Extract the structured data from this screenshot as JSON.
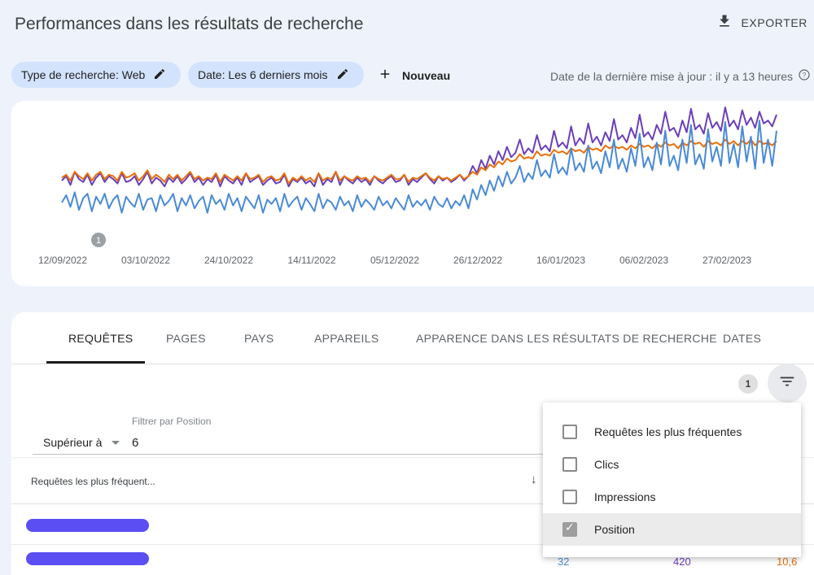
{
  "header": {
    "title": "Performances dans les résultats de recherche",
    "export_label": "EXPORTER",
    "export_icon": "download-icon"
  },
  "filters": {
    "search_type_chip": "Type de recherche: Web",
    "date_chip": "Date: Les 6 derniers mois",
    "new_label": "Nouveau",
    "last_update": "Date de la dernière mise à jour : il y a 13 heures"
  },
  "chart_data": {
    "type": "line",
    "x_ticks": [
      "12/09/2022",
      "03/10/2022",
      "24/10/2022",
      "14/11/2022",
      "05/12/2022",
      "26/12/2022",
      "16/01/2023",
      "06/02/2023",
      "27/02/2023"
    ],
    "annotation": "1",
    "grid": false,
    "colors": {
      "clics": "#4a8ad6",
      "impressions": "#6b3fb8",
      "position": "#e8710a"
    },
    "series": [
      {
        "color": "#6b3fb8",
        "values": [
          50,
          53,
          47,
          56,
          51,
          49,
          54,
          47,
          52,
          55,
          49,
          53,
          51,
          48,
          55,
          49,
          50,
          53,
          47,
          51,
          56,
          48,
          52,
          50,
          46,
          52,
          49,
          53,
          48,
          51,
          55,
          49,
          52,
          47,
          51,
          49,
          54,
          46,
          53,
          50,
          48,
          52,
          47,
          55,
          49,
          51,
          53,
          47,
          50,
          52,
          48,
          49,
          54,
          46,
          51,
          49,
          52,
          48,
          50,
          46,
          55,
          47,
          51,
          49,
          56,
          47,
          53,
          50,
          48,
          52,
          49,
          51,
          47,
          53,
          50,
          48,
          51,
          53,
          49,
          50,
          54,
          47,
          51,
          49,
          52,
          55,
          51,
          48,
          53,
          50,
          52,
          49,
          51,
          54,
          50,
          53,
          60,
          55,
          64,
          58,
          67,
          61,
          70,
          64,
          73,
          66,
          69,
          78,
          68,
          72,
          69,
          81,
          71,
          74,
          70,
          84,
          73,
          76,
          72,
          87,
          74,
          79,
          75,
          89,
          76,
          80,
          74,
          83,
          77,
          92,
          78,
          81,
          76,
          86,
          79,
          95,
          80,
          83,
          78,
          88,
          82,
          97,
          84,
          86,
          80,
          91,
          83,
          99,
          85,
          88,
          82,
          96,
          86,
          90,
          84,
          100,
          87,
          91,
          85,
          98,
          88,
          93,
          86,
          97,
          89,
          91,
          87,
          95
        ]
      },
      {
        "color": "#e8710a",
        "values": [
          52,
          54,
          50,
          56,
          53,
          51,
          55,
          50,
          54,
          56,
          51,
          54,
          53,
          50,
          56,
          52,
          53,
          55,
          50,
          53,
          57,
          51,
          54,
          52,
          49,
          54,
          51,
          54,
          50,
          53,
          56,
          51,
          53,
          50,
          52,
          51,
          55,
          49,
          54,
          52,
          50,
          53,
          50,
          55,
          51,
          52,
          54,
          49,
          52,
          53,
          50,
          51,
          55,
          48,
          52,
          50,
          53,
          50,
          52,
          49,
          55,
          50,
          52,
          51,
          56,
          50,
          53,
          51,
          50,
          53,
          51,
          52,
          49,
          53,
          51,
          50,
          52,
          54,
          51,
          51,
          54,
          49,
          52,
          51,
          53,
          55,
          52,
          50,
          53,
          51,
          52,
          50,
          52,
          54,
          51,
          53,
          56,
          54,
          59,
          57,
          61,
          59,
          63,
          61,
          65,
          63,
          64,
          68,
          65,
          66,
          65,
          70,
          67,
          68,
          67,
          71,
          69,
          70,
          68,
          72,
          70,
          71,
          69,
          73,
          71,
          72,
          70,
          74,
          72,
          74,
          72,
          73,
          71,
          74,
          72,
          75,
          73,
          74,
          72,
          75,
          73,
          76,
          74,
          75,
          72,
          76,
          74,
          77,
          75,
          76,
          73,
          77,
          75,
          76,
          74,
          78,
          75,
          77,
          74,
          77,
          75,
          78,
          74,
          77,
          75,
          76,
          74,
          77
        ]
      },
      {
        "color": "#4a8ad6",
        "values": [
          35,
          40,
          32,
          42,
          30,
          38,
          41,
          29,
          39,
          34,
          41,
          31,
          37,
          40,
          28,
          39,
          35,
          32,
          41,
          30,
          37,
          38,
          29,
          40,
          33,
          36,
          41,
          29,
          38,
          33,
          40,
          31,
          36,
          39,
          28,
          40,
          34,
          37,
          30,
          41,
          33,
          38,
          29,
          39,
          35,
          31,
          40,
          28,
          37,
          34,
          38,
          29,
          41,
          32,
          36,
          39,
          30,
          38,
          34,
          29,
          41,
          31,
          37,
          35,
          30,
          39,
          33,
          36,
          29,
          40,
          32,
          37,
          34,
          30,
          39,
          33,
          36,
          31,
          38,
          34,
          30,
          40,
          32,
          36,
          33,
          37,
          30,
          39,
          34,
          32,
          38,
          31,
          36,
          33,
          40,
          31,
          44,
          37,
          47,
          40,
          50,
          43,
          53,
          46,
          56,
          48,
          52,
          60,
          49,
          55,
          51,
          64,
          53,
          57,
          52,
          68,
          55,
          59,
          54,
          72,
          57,
          62,
          56,
          74,
          58,
          63,
          55,
          70,
          59,
          78,
          58,
          65,
          56,
          72,
          60,
          82,
          59,
          66,
          57,
          76,
          61,
          84,
          60,
          67,
          57,
          78,
          62,
          88,
          61,
          68,
          58,
          85,
          63,
          73,
          60,
          90,
          62,
          75,
          59,
          87,
          63,
          80,
          58,
          91,
          62,
          78,
          60,
          84
        ]
      }
    ]
  },
  "tabs": [
    "REQUÊTES",
    "PAGES",
    "PAYS",
    "APPAREILS",
    "APPARENCE DANS LES RÉSULTATS DE RECHERCHE",
    "DATES"
  ],
  "table": {
    "filter_count": "1",
    "filter_label": "Filtrer par Position",
    "filter_operator": "Supérieur à",
    "filter_value": "6",
    "column_queries": "Requêtes les plus fréquent...",
    "sort_arrow": "↓",
    "rows": [
      {
        "clicks": "",
        "impressions": "",
        "position": ""
      },
      {
        "clicks": "32",
        "impressions": "420",
        "position": "10,6"
      }
    ]
  },
  "metric_menu": {
    "items": [
      {
        "label": "Requêtes les plus fréquentes",
        "checked": false
      },
      {
        "label": "Clics",
        "checked": false
      },
      {
        "label": "Impressions",
        "checked": false
      },
      {
        "label": "Position",
        "checked": true
      }
    ]
  }
}
